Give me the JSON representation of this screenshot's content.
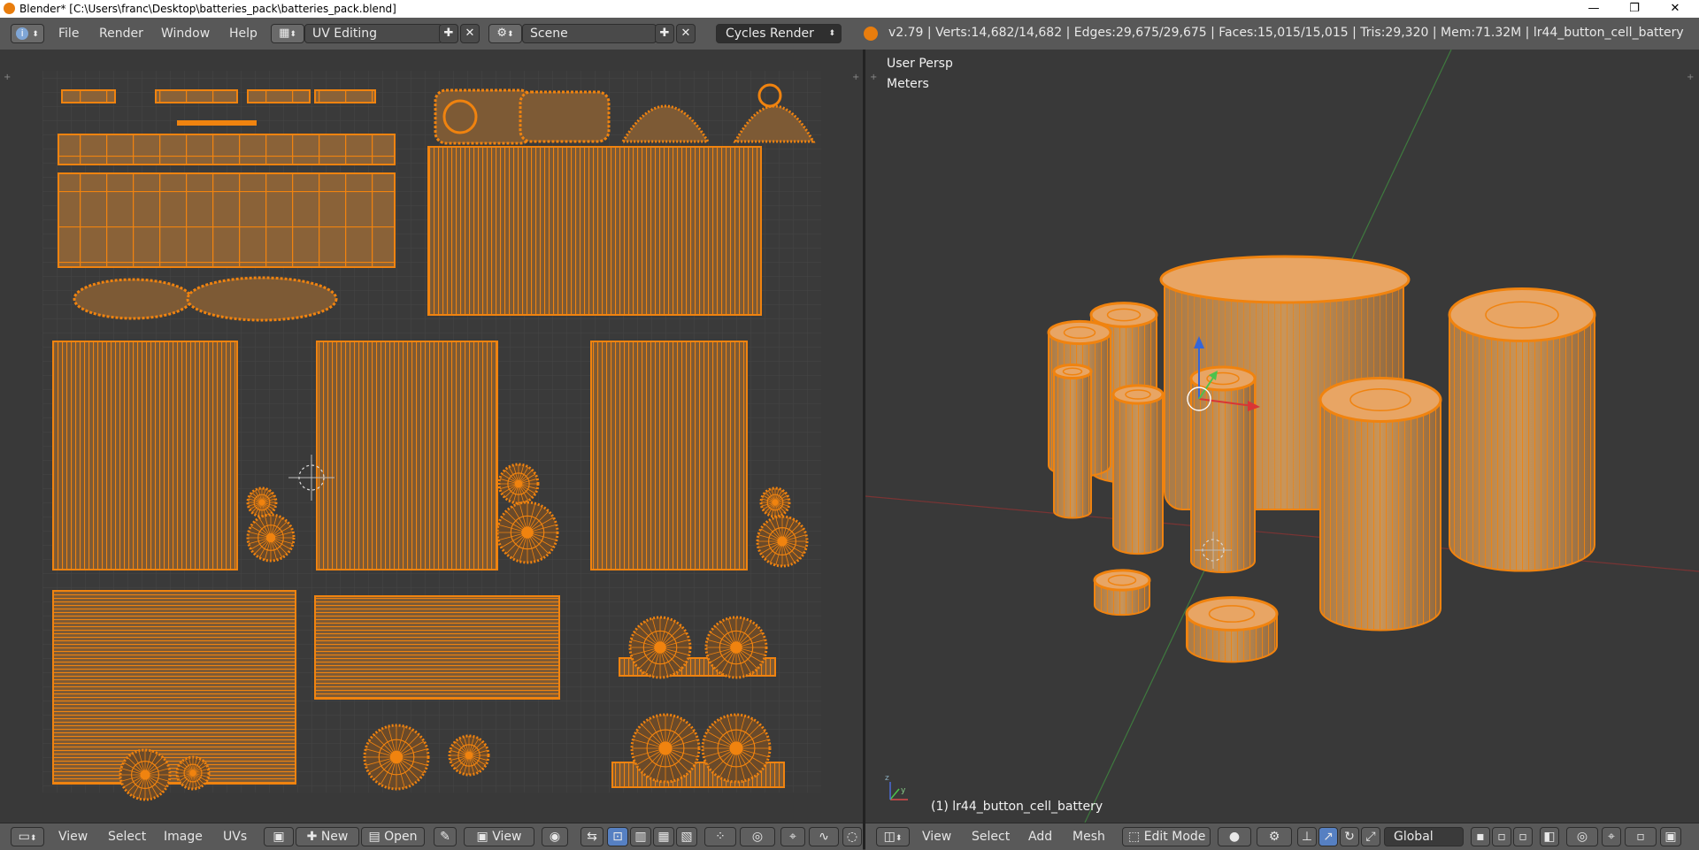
{
  "window": {
    "title": "Blender* [C:\\Users\\franc\\Desktop\\batteries_pack\\batteries_pack.blend]",
    "minimize": "—",
    "restore": "❐",
    "close": "✕"
  },
  "info_header": {
    "editor_icon": "i",
    "menus": [
      "File",
      "Render",
      "Window",
      "Help"
    ],
    "screen_layout": "UV Editing",
    "scene": "Scene",
    "render_engine": "Cycles Render",
    "stats": "v2.79 | Verts:14,682/14,682 | Edges:29,675/29,675 | Faces:15,015/15,015 | Tris:29,320 | Mem:71.32M | lr44_button_cell_battery"
  },
  "viewport": {
    "view_name": "User Persp",
    "units": "Meters",
    "object_label": "(1) lr44_button_cell_battery"
  },
  "uv_footer": {
    "menus": [
      "View",
      "Select",
      "Image",
      "UVs"
    ],
    "new_label": "New",
    "open_label": "Open",
    "view_dropdown": "View"
  },
  "view3d_footer": {
    "menus": [
      "View",
      "Select",
      "Add",
      "Mesh"
    ],
    "mode": "Edit Mode",
    "orientation": "Global"
  },
  "colors": {
    "wire": "#f0830f",
    "wire_fill": "#8a6238",
    "background": "#393939",
    "header": "#585858",
    "accent_blue": "#5680c2"
  }
}
